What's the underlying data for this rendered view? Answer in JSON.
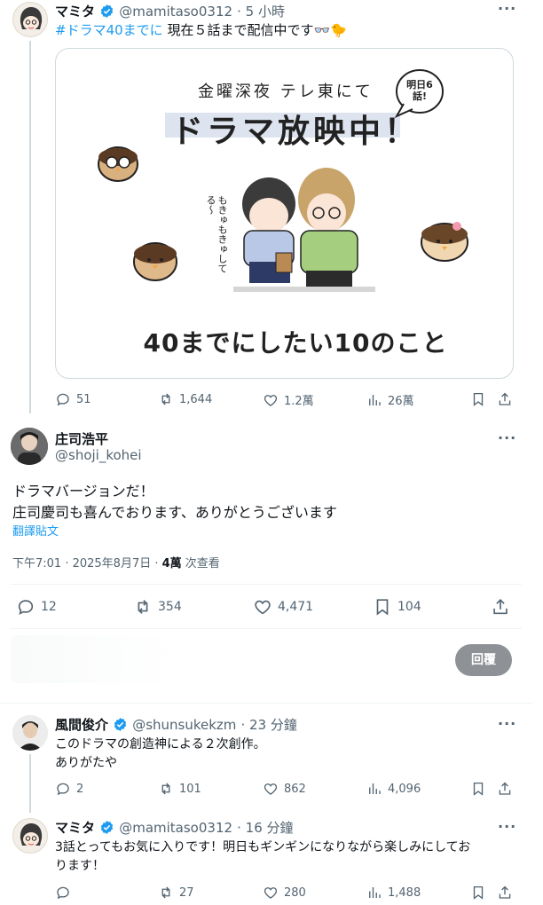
{
  "post1": {
    "name": "マミタ",
    "handle": "@mamitaso0312",
    "time": "· 5 小時",
    "hashtag": "#ドラマ40までに",
    "text": "現在５話まで配信中です👓🐤",
    "image": {
      "banner_top": "金曜深夜 テレ東にて",
      "banner_main": "ドラマ放映中！",
      "bubble": "明日6話!",
      "side_text_1": "もきゅもきゅしてる〜",
      "bottom_title": "40までにしたい10のこと"
    },
    "stats": {
      "replies": "51",
      "reposts": "1,644",
      "likes": "1.2萬",
      "views": "26萬"
    }
  },
  "post2": {
    "name": "庄司浩平",
    "handle": "@shoji_kohei",
    "line1": "ドラマバージョンだ！",
    "line2": "庄司慶司も喜んでおります、ありがとうございます",
    "translate": "翻譯貼文",
    "timestamp": "下午7:01 · 2025年8月7日 · ",
    "views_count": "4萬",
    "views_label": " 次查看",
    "stats": {
      "replies": "12",
      "reposts": "354",
      "likes": "4,471",
      "bookmarks": "104"
    }
  },
  "reply_box": {
    "button": "回覆"
  },
  "post3": {
    "name": "風間俊介",
    "handle": "@shunsukekzm",
    "time": "· 23 分鐘",
    "line1": "このドラマの創造神による２次創作。",
    "line2": "ありがたや",
    "stats": {
      "replies": "2",
      "reposts": "101",
      "likes": "862",
      "views": "4,096"
    }
  },
  "post4": {
    "name": "マミタ",
    "handle": "@mamitaso0312",
    "time": "· 16 分鐘",
    "line1": "3話とってもお気に入りです！明日もギンギンになりながら楽しみにしてお",
    "line2": "ります！",
    "stats": {
      "replies": "",
      "reposts": "27",
      "likes": "280",
      "views": "1,488"
    }
  },
  "colors": {
    "accent": "#1d9bf0",
    "secondary_text": "#536471",
    "banner": "#dde4f0"
  }
}
